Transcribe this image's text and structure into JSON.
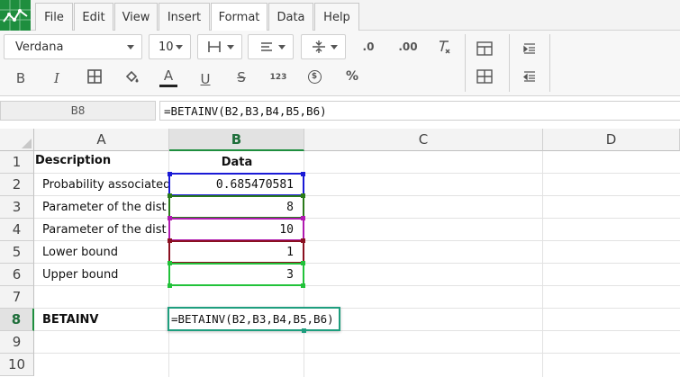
{
  "menu": {
    "items": [
      {
        "label": "File"
      },
      {
        "label": "Edit"
      },
      {
        "label": "View"
      },
      {
        "label": "Insert"
      },
      {
        "label": "Format"
      },
      {
        "label": "Data"
      },
      {
        "label": "Help"
      }
    ],
    "active": "Format"
  },
  "toolbar": {
    "font_family": "Verdana",
    "font_size": "10",
    "number_format_label": "123",
    "currency_symbol": "$",
    "percent_symbol": "%",
    "decrease_decimals_label": ".0",
    "increase_decimals_label": ".00",
    "bold_label": "B",
    "italic_label": "I",
    "text_color_label": "A",
    "underline_label": "U",
    "strikethrough_label": "S",
    "text_color": "#222222"
  },
  "formula_bar": {
    "name_box": "B8",
    "formula": "=BETAINV(B2,B3,B4,B5,B6)"
  },
  "sheet": {
    "columns": [
      "A",
      "B",
      "C",
      "D"
    ],
    "selected_column": "B",
    "rows": [
      "1",
      "2",
      "3",
      "4",
      "5",
      "6",
      "7",
      "8",
      "9",
      "10"
    ],
    "selected_row": "8",
    "cells": {
      "A1": "Description",
      "B1": "Data",
      "A2": "Probability associated",
      "B2": "0.685470581",
      "A3": "Parameter of the dist",
      "B3": "8",
      "A4": "Parameter of the dist",
      "B4": "10",
      "A5": "Lower bound",
      "B5": "1",
      "A6": "Upper bound",
      "B6": "3",
      "A8": "BETAINV",
      "B8": "=BETAINV(B2,B3,B4,B5,B6)"
    },
    "reference_colors": {
      "B2": "#1a1ad6",
      "B3": "#2a7a1a",
      "B4": "#b01ab0",
      "B5": "#8a1020",
      "B6": "#22c23a"
    },
    "active_cell_color": "#1e9e7e"
  }
}
